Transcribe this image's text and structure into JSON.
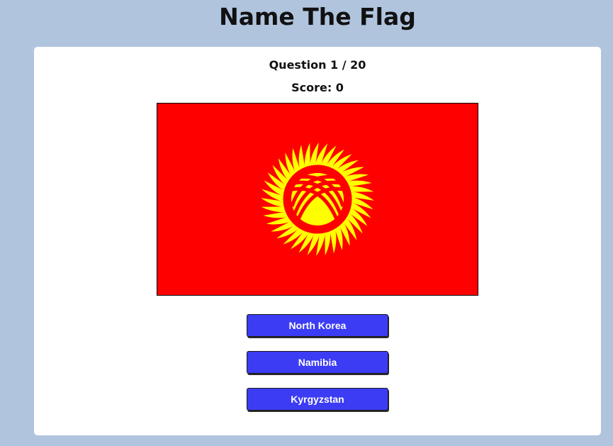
{
  "app": {
    "title": "Name The Flag"
  },
  "quiz": {
    "question_label": "Question 1 / 20",
    "score_label": "Score: 0",
    "flag": {
      "depicts": "Kyrgyzstan",
      "background_color": "#ff0000",
      "sun_color": "#ffff00"
    },
    "answers": [
      {
        "label": "North Korea"
      },
      {
        "label": "Namibia"
      },
      {
        "label": "Kyrgyzstan"
      }
    ]
  },
  "colors": {
    "page_background": "#b0c4de",
    "card_background": "#ffffff",
    "button_background": "#3c3cf5",
    "button_text": "#ffffff"
  }
}
